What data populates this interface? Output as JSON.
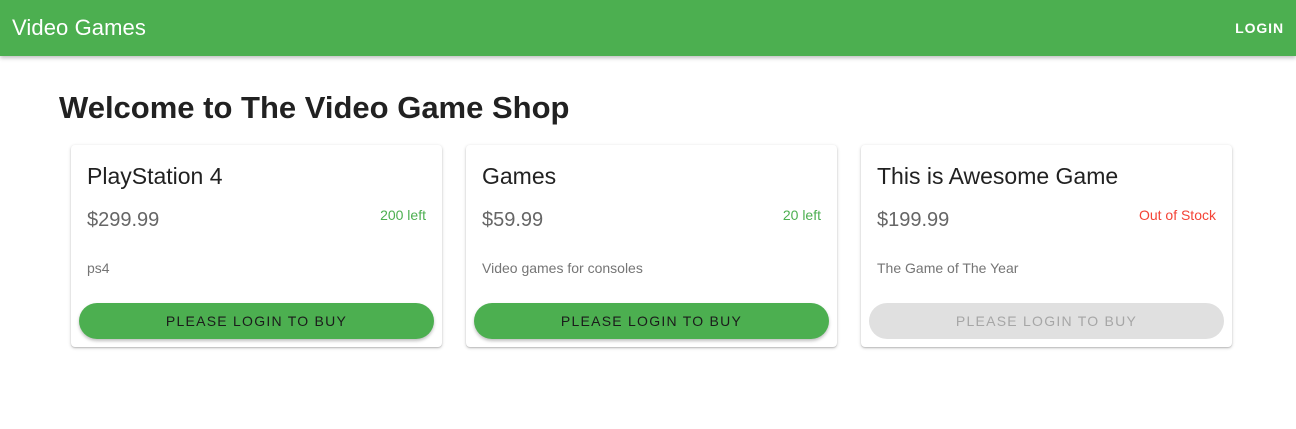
{
  "header": {
    "title": "Video Games",
    "login_label": "LOGIN"
  },
  "main": {
    "title": "Welcome to The Video Game Shop"
  },
  "products": [
    {
      "name": "PlayStation 4",
      "price": "$299.99",
      "stock": "200 left",
      "stock_color": "#4caf50",
      "description": "ps4",
      "button_label": "PLEASE LOGIN TO BUY",
      "button_enabled": true
    },
    {
      "name": "Games",
      "price": "$59.99",
      "stock": "20 left",
      "stock_color": "#4caf50",
      "description": "Video games for consoles",
      "button_label": "PLEASE LOGIN TO BUY",
      "button_enabled": true
    },
    {
      "name": "This is Awesome Game",
      "price": "$199.99",
      "stock": "Out of Stock",
      "stock_color": "#f44336",
      "description": "The Game of The Year",
      "button_label": "PLEASE LOGIN TO BUY",
      "button_enabled": false
    }
  ],
  "colors": {
    "primary": "#4caf50",
    "out_of_stock": "#f44336",
    "disabled_button": "#e0e0e0"
  }
}
